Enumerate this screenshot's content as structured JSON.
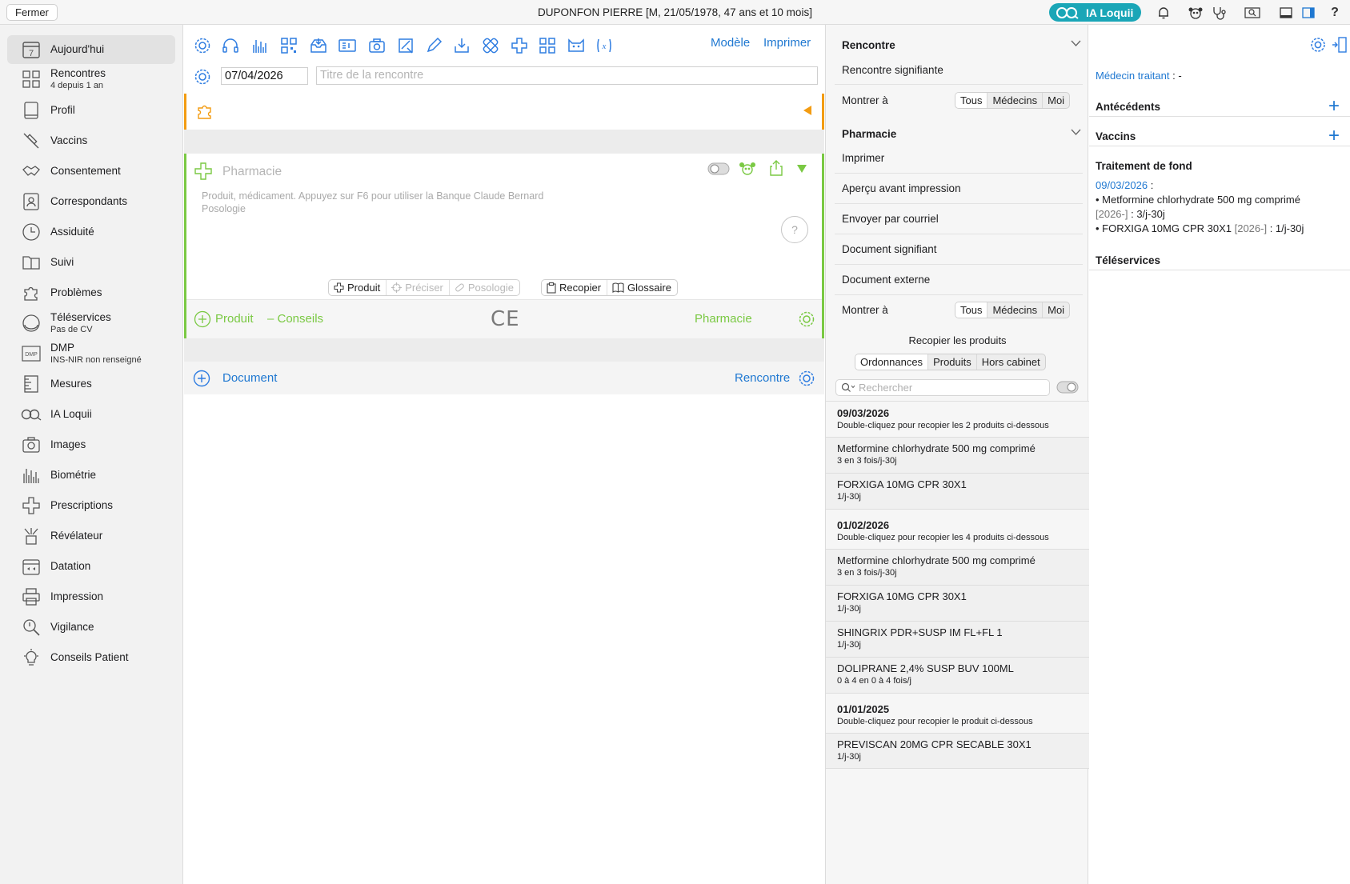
{
  "topbar": {
    "close_label": "Fermer",
    "patient_title": "DUPONFON PIERRE [M, 21/05/1978, 47 ans et 10 mois]",
    "ia_label": "IA Loquii"
  },
  "sidebar": {
    "items": [
      {
        "label": "Aujourd'hui",
        "sub": "",
        "icon": "calendar-icon"
      },
      {
        "label": "Rencontres",
        "sub": "4 depuis 1 an",
        "icon": "grid-icon"
      },
      {
        "label": "Profil",
        "sub": "",
        "icon": "profile-card-icon"
      },
      {
        "label": "Vaccins",
        "sub": "",
        "icon": "syringe-icon"
      },
      {
        "label": "Consentement",
        "sub": "",
        "icon": "handshake-icon"
      },
      {
        "label": "Correspondants",
        "sub": "",
        "icon": "contacts-icon"
      },
      {
        "label": "Assiduité",
        "sub": "",
        "icon": "clock-icon"
      },
      {
        "label": "Suivi",
        "sub": "",
        "icon": "folder-icon"
      },
      {
        "label": "Problèmes",
        "sub": "",
        "icon": "puzzle-icon"
      },
      {
        "label": "Téléservices",
        "sub": "Pas de CV",
        "icon": "card-reader-icon"
      },
      {
        "label": "DMP",
        "sub": "INS-NIR non renseigné",
        "icon": "dmp-icon"
      },
      {
        "label": "Mesures",
        "sub": "",
        "icon": "ruler-icon"
      },
      {
        "label": "IA Loquii",
        "sub": "",
        "icon": "ia-icon"
      },
      {
        "label": "Images",
        "sub": "",
        "icon": "camera-icon"
      },
      {
        "label": "Biométrie",
        "sub": "",
        "icon": "bars-icon"
      },
      {
        "label": "Prescriptions",
        "sub": "",
        "icon": "cross-icon"
      },
      {
        "label": "Révélateur",
        "sub": "",
        "icon": "revealer-icon"
      },
      {
        "label": "Datation",
        "sub": "",
        "icon": "date-icon"
      },
      {
        "label": "Impression",
        "sub": "",
        "icon": "printer-icon"
      },
      {
        "label": "Vigilance",
        "sub": "",
        "icon": "magnifier-icon"
      },
      {
        "label": "Conseils Patient",
        "sub": "",
        "icon": "lightbulb-icon"
      }
    ]
  },
  "encounter": {
    "model_label": "Modèle",
    "print_label": "Imprimer",
    "date": "07/04/2026",
    "title_placeholder": "Titre de la rencontre"
  },
  "pharmacy_block": {
    "title": "Pharmacie",
    "placeholder_line1": "Produit, médicament. Appuyez sur F6 pour utiliser la Banque Claude Bernard",
    "placeholder_line2": "Posologie",
    "help_label": "?",
    "seg_left": [
      "Produit",
      "Préciser",
      "Posologie"
    ],
    "seg_right": [
      "Recopier",
      "Glossaire"
    ],
    "footer_produit": "Produit",
    "footer_conseils": "–  Conseils",
    "footer_ce": "CE",
    "footer_right": "Pharmacie"
  },
  "document_row": {
    "label": "Document",
    "right_label": "Rencontre"
  },
  "options_panel": {
    "rencontre_header": "Rencontre",
    "rencontre_signifiante": "Rencontre signifiante",
    "montrer_a": "Montrer à",
    "seg_options": [
      "Tous",
      "Médecins",
      "Moi"
    ],
    "pharmacie_header": "Pharmacie",
    "pharma_rows": [
      "Imprimer",
      "Aperçu avant impression",
      "Envoyer par courriel",
      "Document signifiant",
      "Document externe"
    ],
    "recopier_title": "Recopier les produits",
    "recopier_tabs": [
      "Ordonnances",
      "Produits",
      "Hors cabinet"
    ],
    "search_placeholder": "Rechercher"
  },
  "history": [
    {
      "main": "09/03/2026",
      "sub": "Double-cliquez pour recopier les 2 produits ci-dessous",
      "header": true
    },
    {
      "main": "Metformine chlorhydrate 500 mg comprimé",
      "sub": "3 en 3 fois/j-30j",
      "header": false
    },
    {
      "main": "FORXIGA 10MG CPR 30X1",
      "sub": "1/j-30j",
      "header": false
    },
    {
      "main": "01/02/2026",
      "sub": "Double-cliquez pour recopier les 4 produits ci-dessous",
      "header": true
    },
    {
      "main": "Metformine chlorhydrate 500 mg comprimé",
      "sub": "3 en 3 fois/j-30j",
      "header": false
    },
    {
      "main": "FORXIGA 10MG CPR 30X1",
      "sub": "1/j-30j",
      "header": false
    },
    {
      "main": "SHINGRIX PDR+SUSP IM FL+FL 1",
      "sub": "1/j-30j",
      "header": false
    },
    {
      "main": "DOLIPRANE 2,4% SUSP BUV 100ML",
      "sub": "0 à 4 en 0 à 4 fois/j",
      "header": false
    },
    {
      "main": "01/01/2025",
      "sub": "Double-cliquez pour recopier le produit ci-dessous",
      "header": true
    },
    {
      "main": "PREVISCAN 20MG CPR SECABLE 30X1",
      "sub": "1/j-30j",
      "header": false
    }
  ],
  "summary": {
    "medecin_label": "Médecin traitant",
    "medecin_value": " : -",
    "antecedents": "Antécédents",
    "vaccins": "Vaccins",
    "traitement": "Traitement de fond",
    "traitement_date": "09/03/2026",
    "traitement_colon": " :",
    "med1": "• Metformine chlorhydrate 500 mg comprimé",
    "med1_tag": "[2026-]",
    "med1_dose": " : 3/j-30j",
    "med2": "• FORXIGA 10MG CPR 30X1",
    "med2_tag": " [2026-]",
    "med2_dose": " : 1/j-30j",
    "teleservices": "Téléservices"
  },
  "colors": {
    "accent_blue": "#1f78d1",
    "ia_teal": "#1aa6b7",
    "pharma_green": "#7ac943",
    "problem_orange": "#f39c12"
  }
}
